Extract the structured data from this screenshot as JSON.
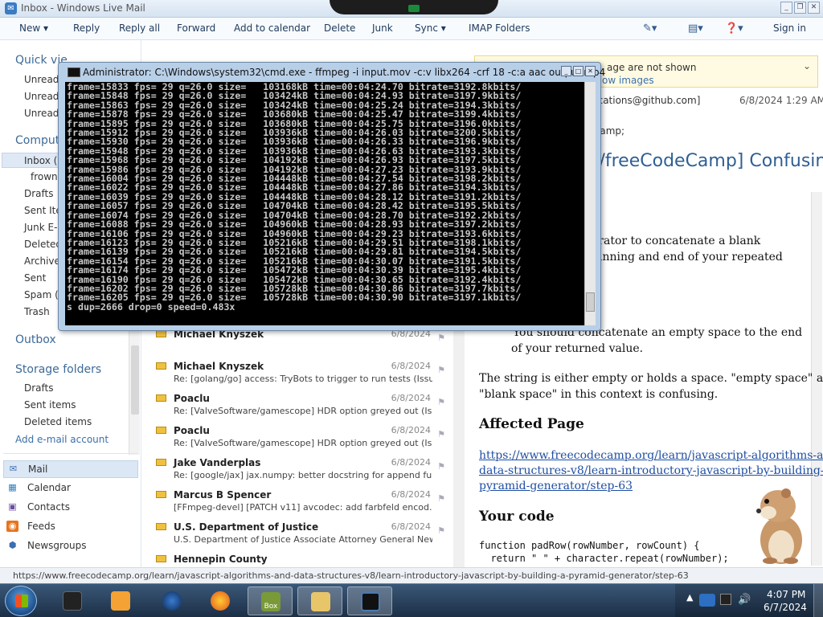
{
  "window": {
    "title": "Inbox - Windows Live Mail"
  },
  "toolbar": {
    "new": "New",
    "reply": "Reply",
    "reply_all": "Reply all",
    "forward": "Forward",
    "add_to_calendar": "Add to calendar",
    "delete": "Delete",
    "junk": "Junk",
    "sync": "Sync",
    "imap_folders": "IMAP Folders",
    "sign_in": "Sign in"
  },
  "sidebar": {
    "quick_views": "Quick vie",
    "quick_items": [
      "Unread",
      "Unread",
      "Unread"
    ],
    "computer": "Comput",
    "inbox": "Inbox (",
    "inbox_sub": "frowni",
    "folders": [
      "Drafts",
      "Sent Iter",
      "Junk E-r",
      "Deleted",
      "Archives",
      "Sent",
      "Spam (",
      "Trash"
    ],
    "outbox": "Outbox",
    "storage": "Storage folders",
    "storage_items": [
      "Drafts",
      "Sent items",
      "Deleted items"
    ],
    "add_account": "Add e-mail account",
    "modules": [
      "Mail",
      "Calendar",
      "Contacts",
      "Feeds",
      "Newsgroups"
    ]
  },
  "messages": [
    {
      "from": "Michael Knyszek",
      "date": "6/8/2024",
      "subject": ""
    },
    {
      "from": "Michael Knyszek",
      "date": "6/8/2024",
      "subject": "Re: [golang/go] access: TryBots to trigger to run tests (Issue..."
    },
    {
      "from": "Michael Knyszek",
      "date": "6/8/2024",
      "subject": "Re: [golang/go] access: TryBots to trigger to run tests (Issue..."
    },
    {
      "from": "Poaclu",
      "date": "6/8/2024",
      "subject": "Re: [ValveSoftware/gamescope] HDR option greyed out (Iss..."
    },
    {
      "from": "Poaclu",
      "date": "6/8/2024",
      "subject": "Re: [ValveSoftware/gamescope] HDR option greyed out (Iss..."
    },
    {
      "from": "Jake Vanderplas",
      "date": "6/8/2024",
      "subject": "Re: [google/jax] jax.numpy: better docstring for append fun..."
    },
    {
      "from": "Marcus B Spencer",
      "date": "6/8/2024",
      "subject": "[FFmpeg-devel] [PATCH v11] avcodec: add farbfeld encod..."
    },
    {
      "from": "U.S. Department of Justice",
      "date": "6/8/2024",
      "subject": "U.S. Department of Justice Associate Attorney General New..."
    },
    {
      "from": "Hennepin County",
      "date": "",
      "subject": ""
    }
  ],
  "reading": {
    "info_line1": "age are not shown",
    "info_line2": "ow images",
    "from": "tifications@github.com]",
    "date": "6/8/2024 1:29 AM",
    "to": "Camp;",
    "subject": "o/freeCodeCamp] Confusin",
    "p1a": "erator to concatenate a blank",
    "p1b": "ginning and end of your repeated",
    "p2a": "You should concatenate an empty space to the end",
    "p2b": "of your returned value.",
    "p3a": "The string is either empty or holds a space. \"empty space\" and",
    "p3b": "\"blank space\" in this context is confusing.",
    "affected": "Affected Page",
    "link1": "https://www.freecodecamp.org/learn/javascript-algorithms-and-",
    "link2": "data-structures-v8/learn-introductory-javascript-by-building-a-",
    "link3": "pyramid-generator/step-63",
    "your_code": "Your code",
    "code1": "function padRow(rowNumber, rowCount) {",
    "code2": "  return \" \" + character.repeat(rowNumber);"
  },
  "status": {
    "text": "https://www.freecodecamp.org/learn/javascript-algorithms-and-data-structures-v8/learn-introductory-javascript-by-building-a-pyramid-generator/step-63"
  },
  "cmd": {
    "title": "Administrator: C:\\Windows\\system32\\cmd.exe - ffmpeg  -i input.mov -c:v libx264 -crf 18 -c:a aac output.mp4",
    "text": "frame=15833 fps= 29 q=26.0 size=   103168kB time=00:04:24.70 bitrate=3192.8kbits/\nframe=15848 fps= 29 q=26.0 size=   103424kB time=00:04:24.93 bitrate=3197.9kbits/\nframe=15863 fps= 29 q=26.0 size=   103424kB time=00:04:25.24 bitrate=3194.3kbits/\nframe=15878 fps= 29 q=26.0 size=   103680kB time=00:04:25.47 bitrate=3199.4kbits/\nframe=15895 fps= 29 q=26.0 size=   103680kB time=00:04:25.75 bitrate=3196.0kbits/\nframe=15912 fps= 29 q=26.0 size=   103936kB time=00:04:26.03 bitrate=3200.5kbits/\nframe=15930 fps= 29 q=26.0 size=   103936kB time=00:04:26.33 bitrate=3196.9kbits/\nframe=15948 fps= 29 q=26.0 size=   103936kB time=00:04:26.63 bitrate=3193.3kbits/\nframe=15968 fps= 29 q=26.0 size=   104192kB time=00:04:26.93 bitrate=3197.5kbits/\nframe=15986 fps= 29 q=26.0 size=   104192kB time=00:04:27.23 bitrate=3193.9kbits/\nframe=16004 fps= 29 q=26.0 size=   104448kB time=00:04:27.54 bitrate=3198.2kbits/\nframe=16022 fps= 29 q=26.0 size=   104448kB time=00:04:27.86 bitrate=3194.3kbits/\nframe=16039 fps= 29 q=26.0 size=   104448kB time=00:04:28.12 bitrate=3191.2kbits/\nframe=16057 fps= 29 q=26.0 size=   104704kB time=00:04:28.42 bitrate=3195.5kbits/\nframe=16074 fps= 29 q=26.0 size=   104704kB time=00:04:28.70 bitrate=3192.2kbits/\nframe=16088 fps= 29 q=26.0 size=   104960kB time=00:04:28.93 bitrate=3197.2kbits/\nframe=16106 fps= 29 q=26.0 size=   104960kB time=00:04:29.23 bitrate=3193.6kbits/\nframe=16123 fps= 29 q=26.0 size=   105216kB time=00:04:29.51 bitrate=3198.1kbits/\nframe=16139 fps= 29 q=26.0 size=   105216kB time=00:04:29.81 bitrate=3194.5kbits/\nframe=16154 fps= 29 q=26.0 size=   105216kB time=00:04:30.07 bitrate=3191.5kbits/\nframe=16174 fps= 29 q=26.0 size=   105472kB time=00:04:30.39 bitrate=3195.4kbits/\nframe=16190 fps= 29 q=26.0 size=   105472kB time=00:04:30.65 bitrate=3192.4kbits/\nframe=16202 fps= 29 q=26.0 size=   105728kB time=00:04:30.86 bitrate=3197.7kbits/\nframe=16205 fps= 29 q=26.0 size=   105728kB time=00:04:30.90 bitrate=3197.1kbits/\ns dup=2666 drop=0 speed=0.483x"
  },
  "taskbar": {
    "clock_time": "4:07 PM",
    "clock_date": "6/7/2024",
    "box_label": "Box"
  },
  "colors": {
    "accent": "#3d6a98",
    "taskbar": "#1c2f46",
    "console_bg": "#000000"
  }
}
